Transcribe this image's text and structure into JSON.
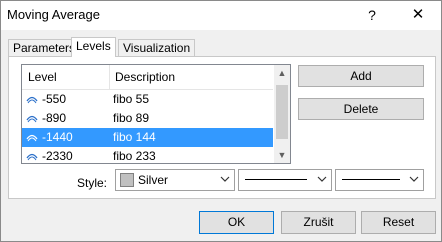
{
  "window": {
    "title": "Moving Average",
    "help": "?",
    "close": "✕"
  },
  "tabs": [
    {
      "label": "Parameters"
    },
    {
      "label": "Levels"
    },
    {
      "label": "Visualization"
    }
  ],
  "levels": {
    "headers": {
      "level": "Level",
      "description": "Description"
    },
    "rows": [
      {
        "level": "-550",
        "description": "fibo 55"
      },
      {
        "level": "-890",
        "description": "fibo 89"
      },
      {
        "level": "-1440",
        "description": "fibo 144"
      },
      {
        "level": "-2330",
        "description": "fibo 233"
      }
    ],
    "selected_index": 2
  },
  "buttons": {
    "add": "Add",
    "delete": "Delete",
    "ok": "OK",
    "cancel": "Zrušit",
    "reset": "Reset"
  },
  "style": {
    "label": "Style:",
    "color_name": "Silver",
    "color_hex": "#c0c0c0"
  },
  "colors": {
    "accent": "#3399ff",
    "icon": "#2a6fc9"
  }
}
